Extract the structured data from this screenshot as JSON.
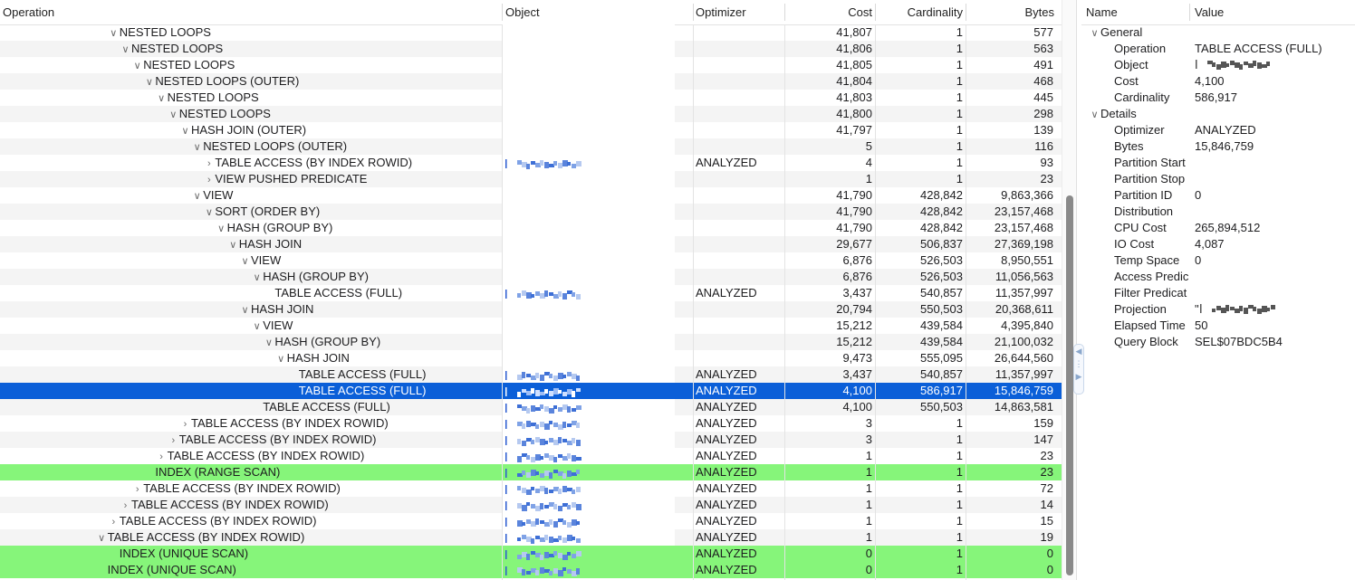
{
  "columns": {
    "operation": "Operation",
    "object": "Object",
    "optimizer": "Optimizer",
    "cost": "Cost",
    "cardinality": "Cardinality",
    "bytes": "Bytes"
  },
  "plan_rows": [
    {
      "indent": 9,
      "chevron": "down",
      "op": "NESTED LOOPS",
      "obj": false,
      "optimizer": "",
      "cost": "41,807",
      "card": "1",
      "bytes": "577"
    },
    {
      "indent": 10,
      "chevron": "down",
      "op": "NESTED LOOPS",
      "obj": false,
      "optimizer": "",
      "cost": "41,806",
      "card": "1",
      "bytes": "563"
    },
    {
      "indent": 11,
      "chevron": "down",
      "op": "NESTED LOOPS",
      "obj": false,
      "optimizer": "",
      "cost": "41,805",
      "card": "1",
      "bytes": "491"
    },
    {
      "indent": 12,
      "chevron": "down",
      "op": "NESTED LOOPS (OUTER)",
      "obj": false,
      "optimizer": "",
      "cost": "41,804",
      "card": "1",
      "bytes": "468"
    },
    {
      "indent": 13,
      "chevron": "down",
      "op": "NESTED LOOPS",
      "obj": false,
      "optimizer": "",
      "cost": "41,803",
      "card": "1",
      "bytes": "445"
    },
    {
      "indent": 14,
      "chevron": "down",
      "op": "NESTED LOOPS",
      "obj": false,
      "optimizer": "",
      "cost": "41,800",
      "card": "1",
      "bytes": "298"
    },
    {
      "indent": 15,
      "chevron": "down",
      "op": "HASH JOIN (OUTER)",
      "obj": false,
      "optimizer": "",
      "cost": "41,797",
      "card": "1",
      "bytes": "139"
    },
    {
      "indent": 16,
      "chevron": "down",
      "op": "NESTED LOOPS (OUTER)",
      "obj": false,
      "optimizer": "",
      "cost": "5",
      "card": "1",
      "bytes": "116"
    },
    {
      "indent": 17,
      "chevron": "right",
      "op": "TABLE ACCESS (BY INDEX ROWID)",
      "obj": true,
      "optimizer": "ANALYZED",
      "cost": "4",
      "card": "1",
      "bytes": "93"
    },
    {
      "indent": 17,
      "chevron": "right",
      "op": "VIEW PUSHED PREDICATE",
      "obj": false,
      "optimizer": "",
      "cost": "1",
      "card": "1",
      "bytes": "23"
    },
    {
      "indent": 16,
      "chevron": "down",
      "op": "VIEW",
      "obj": false,
      "optimizer": "",
      "cost": "41,790",
      "card": "428,842",
      "bytes": "9,863,366"
    },
    {
      "indent": 17,
      "chevron": "down",
      "op": "SORT (ORDER BY)",
      "obj": false,
      "optimizer": "",
      "cost": "41,790",
      "card": "428,842",
      "bytes": "23,157,468"
    },
    {
      "indent": 18,
      "chevron": "down",
      "op": "HASH (GROUP BY)",
      "obj": false,
      "optimizer": "",
      "cost": "41,790",
      "card": "428,842",
      "bytes": "23,157,468"
    },
    {
      "indent": 19,
      "chevron": "down",
      "op": "HASH JOIN",
      "obj": false,
      "optimizer": "",
      "cost": "29,677",
      "card": "506,837",
      "bytes": "27,369,198"
    },
    {
      "indent": 20,
      "chevron": "down",
      "op": "VIEW",
      "obj": false,
      "optimizer": "",
      "cost": "6,876",
      "card": "526,503",
      "bytes": "8,950,551"
    },
    {
      "indent": 21,
      "chevron": "down",
      "op": "HASH (GROUP BY)",
      "obj": false,
      "optimizer": "",
      "cost": "6,876",
      "card": "526,503",
      "bytes": "11,056,563"
    },
    {
      "indent": 22,
      "chevron": "",
      "op": "TABLE ACCESS (FULL)",
      "obj": true,
      "optimizer": "ANALYZED",
      "cost": "3,437",
      "card": "540,857",
      "bytes": "11,357,997"
    },
    {
      "indent": 20,
      "chevron": "down",
      "op": "HASH JOIN",
      "obj": false,
      "optimizer": "",
      "cost": "20,794",
      "card": "550,503",
      "bytes": "20,368,611"
    },
    {
      "indent": 21,
      "chevron": "down",
      "op": "VIEW",
      "obj": false,
      "optimizer": "",
      "cost": "15,212",
      "card": "439,584",
      "bytes": "4,395,840"
    },
    {
      "indent": 22,
      "chevron": "down",
      "op": "HASH (GROUP BY)",
      "obj": false,
      "optimizer": "",
      "cost": "15,212",
      "card": "439,584",
      "bytes": "21,100,032"
    },
    {
      "indent": 23,
      "chevron": "down",
      "op": "HASH JOIN",
      "obj": false,
      "optimizer": "",
      "cost": "9,473",
      "card": "555,095",
      "bytes": "26,644,560"
    },
    {
      "indent": 24,
      "chevron": "",
      "op": "TABLE ACCESS (FULL)",
      "obj": true,
      "optimizer": "ANALYZED",
      "cost": "3,437",
      "card": "540,857",
      "bytes": "11,357,997"
    },
    {
      "indent": 24,
      "chevron": "",
      "op": "TABLE ACCESS (FULL)",
      "obj": true,
      "optimizer": "ANALYZED",
      "cost": "4,100",
      "card": "586,917",
      "bytes": "15,846,759",
      "state": "selected"
    },
    {
      "indent": 21,
      "chevron": "",
      "op": "TABLE ACCESS (FULL)",
      "obj": true,
      "optimizer": "ANALYZED",
      "cost": "4,100",
      "card": "550,503",
      "bytes": "14,863,581"
    },
    {
      "indent": 15,
      "chevron": "right",
      "op": "TABLE ACCESS (BY INDEX ROWID)",
      "obj": true,
      "optimizer": "ANALYZED",
      "cost": "3",
      "card": "1",
      "bytes": "159"
    },
    {
      "indent": 14,
      "chevron": "right",
      "op": "TABLE ACCESS (BY INDEX ROWID)",
      "obj": true,
      "optimizer": "ANALYZED",
      "cost": "3",
      "card": "1",
      "bytes": "147"
    },
    {
      "indent": 13,
      "chevron": "right",
      "op": "TABLE ACCESS (BY INDEX ROWID)",
      "obj": true,
      "optimizer": "ANALYZED",
      "cost": "1",
      "card": "1",
      "bytes": "23"
    },
    {
      "indent": 12,
      "chevron": "",
      "op": "INDEX (RANGE SCAN)",
      "obj": true,
      "optimizer": "ANALYZED",
      "cost": "1",
      "card": "1",
      "bytes": "23",
      "state": "highlight"
    },
    {
      "indent": 11,
      "chevron": "right",
      "op": "TABLE ACCESS (BY INDEX ROWID)",
      "obj": true,
      "optimizer": "ANALYZED",
      "cost": "1",
      "card": "1",
      "bytes": "72"
    },
    {
      "indent": 10,
      "chevron": "right",
      "op": "TABLE ACCESS (BY INDEX ROWID)",
      "obj": true,
      "optimizer": "ANALYZED",
      "cost": "1",
      "card": "1",
      "bytes": "14"
    },
    {
      "indent": 9,
      "chevron": "right",
      "op": "TABLE ACCESS (BY INDEX ROWID)",
      "obj": true,
      "optimizer": "ANALYZED",
      "cost": "1",
      "card": "1",
      "bytes": "15"
    },
    {
      "indent": 8,
      "chevron": "down",
      "op": "TABLE ACCESS (BY INDEX ROWID)",
      "obj": true,
      "optimizer": "ANALYZED",
      "cost": "1",
      "card": "1",
      "bytes": "19"
    },
    {
      "indent": 9,
      "chevron": "",
      "op": "INDEX (UNIQUE SCAN)",
      "obj": true,
      "optimizer": "ANALYZED",
      "cost": "0",
      "card": "1",
      "bytes": "0",
      "state": "highlight"
    },
    {
      "indent": 8,
      "chevron": "",
      "op": "INDEX (UNIQUE SCAN)",
      "obj": true,
      "optimizer": "ANALYZED",
      "cost": "0",
      "card": "1",
      "bytes": "0",
      "state": "highlight"
    }
  ],
  "properties": {
    "header": {
      "name": "Name",
      "value": "Value"
    },
    "groups": [
      {
        "label": "General",
        "items": [
          {
            "name": "Operation",
            "value": "TABLE ACCESS (FULL)"
          },
          {
            "name": "Object",
            "value": "",
            "redacted": true
          },
          {
            "name": "Cost",
            "value": "4,100"
          },
          {
            "name": "Cardinality",
            "value": "586,917"
          }
        ]
      },
      {
        "label": "Details",
        "items": [
          {
            "name": "Optimizer",
            "value": "ANALYZED"
          },
          {
            "name": "Bytes",
            "value": "15,846,759"
          },
          {
            "name": "Partition Start",
            "value": ""
          },
          {
            "name": "Partition Stop",
            "value": ""
          },
          {
            "name": "Partition ID",
            "value": "0"
          },
          {
            "name": "Distribution",
            "value": ""
          },
          {
            "name": "CPU Cost",
            "value": "265,894,512"
          },
          {
            "name": "IO Cost",
            "value": "4,087"
          },
          {
            "name": "Temp Space",
            "value": "0"
          },
          {
            "name": "Access Predic",
            "value": ""
          },
          {
            "name": "Filter Predicat",
            "value": ""
          },
          {
            "name": "Projection",
            "value": "\"",
            "redacted": true
          },
          {
            "name": "Elapsed Time",
            "value": "50"
          },
          {
            "name": "Query Block",
            "value": "SEL$07BDC5B4"
          }
        ]
      }
    ]
  },
  "colors": {
    "selected": "#0b5fd8",
    "highlight": "#86f57a",
    "alt_row": "#f4f4f4"
  }
}
